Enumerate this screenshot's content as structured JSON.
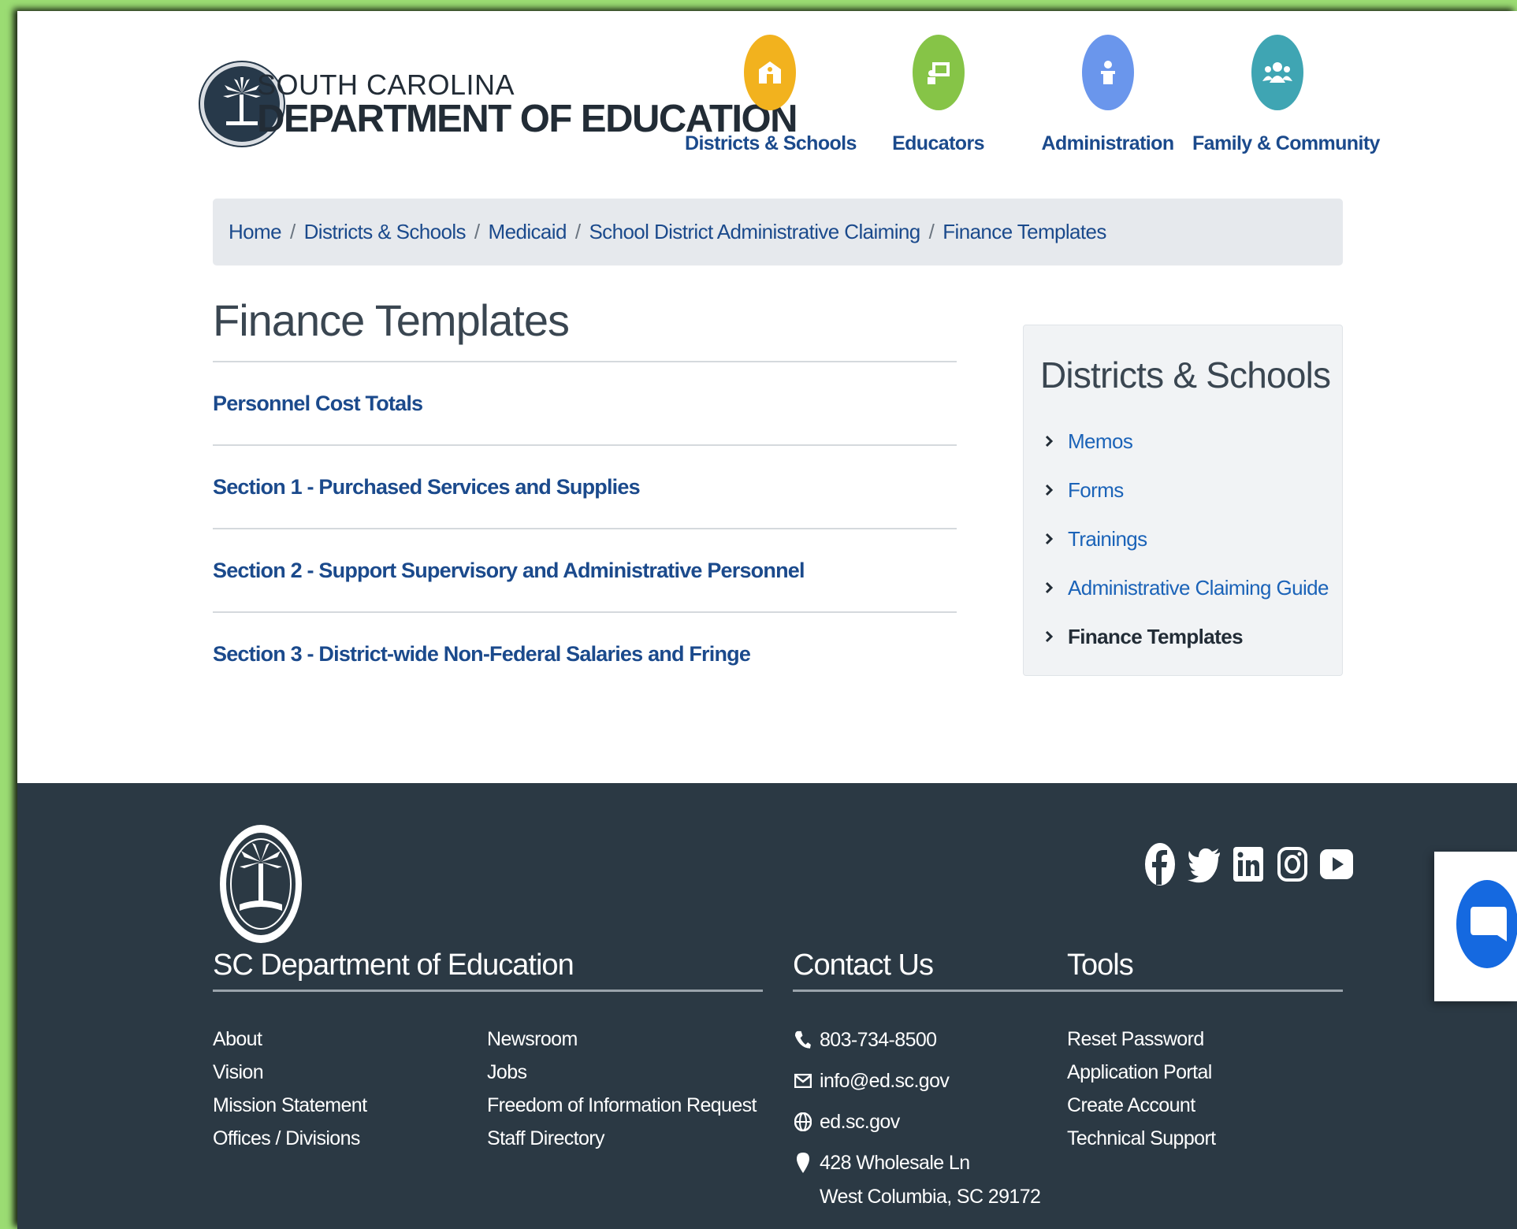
{
  "header": {
    "logo_top": "SOUTH CAROLINA",
    "logo_main": "DEPARTMENT OF EDUCATION",
    "nav": [
      {
        "label": "Districts & Schools",
        "icon": "school-icon",
        "color": "#f2b21e"
      },
      {
        "label": "Educators",
        "icon": "whiteboard-icon",
        "color": "#86c447"
      },
      {
        "label": "Administration",
        "icon": "podium-icon",
        "color": "#6a96ec"
      },
      {
        "label": "Family & Community",
        "icon": "people-icon",
        "color": "#3fa5b3"
      }
    ]
  },
  "breadcrumb": [
    "Home",
    "Districts & Schools",
    "Medicaid",
    "School District Administrative Claiming",
    "Finance Templates"
  ],
  "main": {
    "title": "Finance Templates",
    "documents": [
      "Personnel Cost Totals",
      "Section 1 - Purchased Services and Supplies",
      "Section 2 - Support Supervisory and Administrative Personnel",
      "Section 3 - District-wide Non-Federal Salaries and Fringe"
    ]
  },
  "sidebar": {
    "title": "Districts & Schools",
    "items": [
      "Memos",
      "Forms",
      "Trainings",
      "Administrative Claiming Guide",
      "Finance Templates"
    ],
    "current": "Finance Templates"
  },
  "footer": {
    "social": [
      "facebook-icon",
      "twitter-icon",
      "linkedin-icon",
      "instagram-icon",
      "youtube-icon"
    ],
    "org_heading": "SC Department of Education",
    "org_links_col1": [
      "About",
      "Vision",
      "Mission Statement",
      "Offices / Divisions"
    ],
    "org_links_col2": [
      "Newsroom",
      "Jobs",
      "Freedom of Information Request",
      "Staff Directory"
    ],
    "contact_heading": "Contact Us",
    "phone": "803-734-8500",
    "email": "info@ed.sc.gov",
    "website": "ed.sc.gov",
    "address_line1": "428 Wholesale Ln",
    "address_line2": "West Columbia, SC 29172",
    "tools_heading": "Tools",
    "tools_links": [
      "Reset Password",
      "Application Portal",
      "Create Account",
      "Technical Support"
    ]
  },
  "colors": {
    "link": "#1b4a8c",
    "footer_bg": "#2b3944",
    "breadcrumb_bg": "#e6e9ed",
    "chat_button": "#1569e0"
  }
}
